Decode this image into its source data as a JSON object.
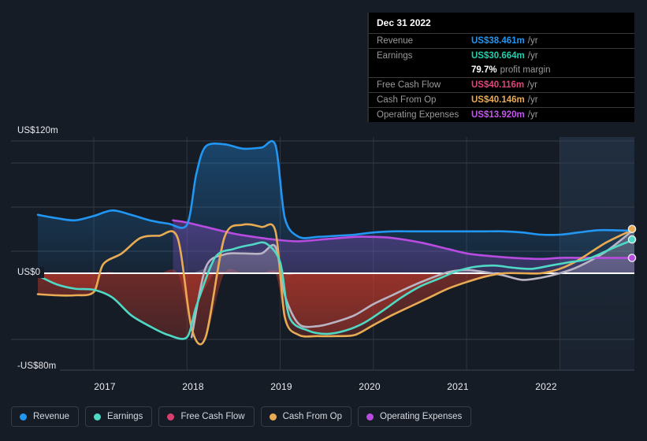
{
  "chart_data": {
    "type": "area",
    "title": "",
    "xlabel": "",
    "ylabel": "",
    "grid": true,
    "legend_position": "bottom-left",
    "ylim": [
      -80,
      120
    ],
    "y_ticks": [
      {
        "label": "US$120m",
        "value": 120
      },
      {
        "label": "US$0",
        "value": 0
      },
      {
        "label": "-US$80m",
        "value": -80
      }
    ],
    "x_ticks": [
      "2017",
      "2018",
      "2019",
      "2020",
      "2021",
      "2022"
    ],
    "forecast_region_start": "2022",
    "series": [
      {
        "name": "Revenue",
        "color": "#2196f3",
        "end_value": 38.461,
        "x": [
          2016.4,
          2016.6,
          2016.8,
          2017.0,
          2017.2,
          2017.4,
          2017.6,
          2017.8,
          2018.0,
          2018.1,
          2018.2,
          2018.4,
          2018.6,
          2018.8,
          2018.95,
          2019.05,
          2019.2,
          2019.4,
          2019.6,
          2019.8,
          2020.0,
          2020.2,
          2020.4,
          2020.6,
          2020.8,
          2021.0,
          2021.2,
          2021.4,
          2021.6,
          2021.8,
          2022.0,
          2022.2,
          2022.4,
          2022.6,
          2022.8
        ],
        "values": [
          53,
          50,
          48,
          52,
          57,
          53,
          48,
          45,
          44,
          90,
          115,
          117,
          113,
          114,
          116,
          50,
          33,
          33,
          34,
          35,
          37,
          38,
          38,
          38,
          38,
          38,
          38,
          38,
          37,
          35,
          35,
          37,
          39,
          39,
          38.461
        ]
      },
      {
        "name": "Earnings",
        "color": "#4fd9c5",
        "end_value": 30.664,
        "x": [
          2016.4,
          2016.6,
          2016.8,
          2017.0,
          2017.2,
          2017.4,
          2017.6,
          2017.8,
          2018.0,
          2018.1,
          2018.3,
          2018.5,
          2018.7,
          2018.85,
          2019.0,
          2019.1,
          2019.3,
          2019.5,
          2019.7,
          2019.9,
          2020.1,
          2020.3,
          2020.5,
          2020.7,
          2020.9,
          2021.1,
          2021.3,
          2021.5,
          2021.7,
          2021.9,
          2022.1,
          2022.3,
          2022.6,
          2022.8
        ],
        "values": [
          -2,
          -10,
          -14,
          -15,
          -22,
          -38,
          -48,
          -56,
          -58,
          -30,
          14,
          22,
          26,
          27,
          10,
          -40,
          -52,
          -55,
          -52,
          -45,
          -34,
          -22,
          -12,
          -5,
          2,
          6,
          7,
          5,
          4,
          7,
          10,
          13,
          24,
          30.664
        ]
      },
      {
        "name": "Free Cash Flow",
        "color": "#d63f6e",
        "end_value": 40.116,
        "x": [
          2018.05,
          2018.2,
          2018.4,
          2018.6,
          2018.8,
          2018.95,
          2019.05,
          2019.2,
          2019.4,
          2019.6,
          2019.8,
          2020.0,
          2020.2,
          2020.4,
          2020.6,
          2020.8,
          2021.0,
          2021.2,
          2021.4,
          2021.6,
          2021.8,
          2022.0,
          2022.2,
          2022.5,
          2022.8
        ],
        "values": [
          -58,
          5,
          17,
          18,
          18,
          24,
          -20,
          -46,
          -48,
          -44,
          -38,
          -28,
          -20,
          -12,
          -5,
          1,
          3,
          1,
          -2,
          -6,
          -4,
          0,
          6,
          20,
          40.116
        ]
      },
      {
        "name": "Cash From Op",
        "color": "#e8ab54",
        "end_value": 40.146,
        "x": [
          2016.4,
          2016.6,
          2016.8,
          2017.0,
          2017.1,
          2017.3,
          2017.5,
          2017.7,
          2017.9,
          2018.05,
          2018.2,
          2018.4,
          2018.6,
          2018.8,
          2018.95,
          2019.05,
          2019.2,
          2019.4,
          2019.6,
          2019.8,
          2020.0,
          2020.2,
          2020.4,
          2020.6,
          2020.8,
          2021.0,
          2021.2,
          2021.4,
          2021.6,
          2021.8,
          2022.0,
          2022.2,
          2022.5,
          2022.8
        ],
        "values": [
          -19,
          -20,
          -20,
          -17,
          8,
          18,
          32,
          34,
          32,
          -50,
          -58,
          32,
          44,
          42,
          38,
          -40,
          -56,
          -57,
          -57,
          -56,
          -47,
          -38,
          -30,
          -22,
          -14,
          -8,
          -3,
          0,
          0,
          0,
          4,
          12,
          28,
          40.146
        ]
      },
      {
        "name": "Operating Expenses",
        "color": "#b84ce0",
        "end_value": 13.92,
        "x": [
          2017.85,
          2018.0,
          2018.2,
          2018.5,
          2018.8,
          2019.0,
          2019.2,
          2019.5,
          2019.8,
          2020.0,
          2020.2,
          2020.5,
          2020.8,
          2021.0,
          2021.2,
          2021.5,
          2021.8,
          2022.0,
          2022.2,
          2022.5,
          2022.8
        ],
        "values": [
          48,
          46,
          42,
          36,
          32,
          30,
          29,
          31,
          33,
          33,
          32,
          28,
          22,
          18,
          16,
          14,
          13,
          14,
          14,
          14,
          13.92
        ]
      }
    ]
  },
  "tooltip": {
    "title": "Dec 31 2022",
    "unit": "/yr",
    "rows": [
      {
        "name": "Revenue",
        "value": "US$38.461m",
        "color": "#2196f3"
      },
      {
        "name": "Earnings",
        "value": "US$30.664m",
        "color": "#1fd1ae"
      },
      {
        "name": "",
        "value": "79.7%",
        "suffix": "profit margin",
        "color": "#ffffff"
      },
      {
        "name": "Free Cash Flow",
        "value": "US$40.116m",
        "color": "#e0457b"
      },
      {
        "name": "Cash From Op",
        "value": "US$40.146m",
        "color": "#e8ab54"
      },
      {
        "name": "Operating Expenses",
        "value": "US$13.920m",
        "color": "#c455f0"
      }
    ]
  },
  "legend": {
    "items": [
      {
        "label": "Revenue",
        "color": "#2196f3"
      },
      {
        "label": "Earnings",
        "color": "#4fd9c5"
      },
      {
        "label": "Free Cash Flow",
        "color": "#d63f6e"
      },
      {
        "label": "Cash From Op",
        "color": "#e8ab54"
      },
      {
        "label": "Operating Expenses",
        "color": "#b84ce0"
      }
    ]
  },
  "axis": {
    "y_labels": [
      "US$120m",
      "US$0",
      "-US$80m"
    ],
    "x_labels": [
      "2017",
      "2018",
      "2019",
      "2020",
      "2021",
      "2022"
    ]
  }
}
